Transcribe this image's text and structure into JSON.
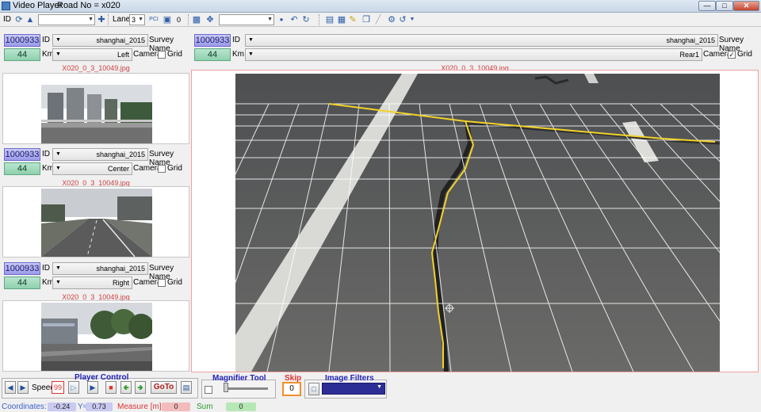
{
  "window": {
    "title": "Video Player",
    "road_label": "Road No = x020"
  },
  "toolbar": {
    "id_label": "ID",
    "lane_label": "Lane",
    "lane_value": "3",
    "counter_value": "0"
  },
  "main_panel": {
    "id": "1000933",
    "id_label": "ID",
    "survey": "shanghai_2015",
    "survey_label": "Survey Name",
    "km": "44",
    "km_label": "Km",
    "camera": "Rear1",
    "camera_label": "Camera",
    "grid_label": "Grid",
    "grid_checked": true,
    "filename": "X020_0_3_10049.jpg"
  },
  "views": [
    {
      "id": "1000933",
      "id_label": "ID",
      "survey": "shanghai_2015",
      "survey_label": "Survey Name",
      "km": "44",
      "km_label": "Km",
      "camera": "Left",
      "camera_label": "Camera",
      "grid_label": "Grid",
      "filename": "X020_0_3_10049.jpg"
    },
    {
      "id": "1000933",
      "id_label": "ID",
      "survey": "shanghai_2015",
      "survey_label": "Survey Name",
      "km": "44",
      "km_label": "Km",
      "camera": "Center",
      "camera_label": "Camera",
      "grid_label": "Grid",
      "filename": "X020_0_3_10049.jpg"
    },
    {
      "id": "1000933",
      "id_label": "ID",
      "survey": "shanghai_2015",
      "survey_label": "Survey Name",
      "km": "44",
      "km_label": "Km",
      "camera": "Right",
      "camera_label": "Camera",
      "grid_label": "Grid",
      "filename": "X020_0_3_10049.jpg"
    }
  ],
  "player": {
    "title": "Player Control",
    "speed_label": "Speed",
    "speed_value": "99",
    "goto_label": "GoTo"
  },
  "magnifier": {
    "title": "Magnifier Tool"
  },
  "skip": {
    "title": "Skip",
    "value": "0"
  },
  "filters": {
    "title": "Image Filters"
  },
  "status": {
    "coordinates_label": "Coordinates:",
    "x_value": "-0.24",
    "y_label": "Y=",
    "y_value": "0.73",
    "measure_label": "Measure [m]:",
    "measure_value": "0",
    "sum_label": "Sum",
    "sum_value": "0"
  },
  "colors": {
    "accent": "#2323b8",
    "id_box": "#a9a9ee",
    "km_box": "#9ed8b9",
    "filename": "#d04040",
    "crack_trace": "#f2d22a"
  }
}
